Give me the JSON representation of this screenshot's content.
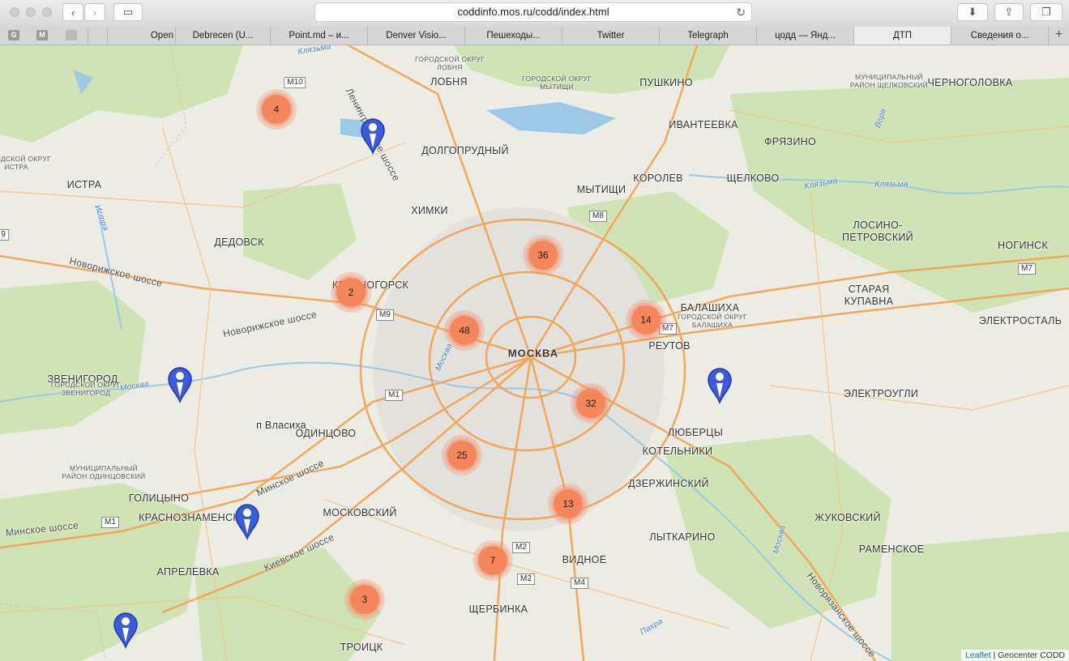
{
  "browser": {
    "url": "coddinfo.mos.ru/codd/index.html",
    "tabs": [
      {
        "label": "Open",
        "active": false
      },
      {
        "label": "Debrecen (U...",
        "active": false
      },
      {
        "label": "Point.md – и...",
        "active": false
      },
      {
        "label": "Denver Visio...",
        "active": false
      },
      {
        "label": "Пешеходы...",
        "active": false
      },
      {
        "label": "Twitter",
        "active": false
      },
      {
        "label": "Telegraph",
        "active": false
      },
      {
        "label": "цодд — Янд...",
        "active": false
      },
      {
        "label": "ДТП",
        "active": true
      },
      {
        "label": "Сведения о...",
        "active": false
      }
    ],
    "bookmarks": [
      "G",
      "M",
      "mail"
    ]
  },
  "map": {
    "places": [
      {
        "name": "ЛОБНЯ"
      },
      {
        "name": "ПУШКИНО"
      },
      {
        "name": "ЧЕРНОГОЛОВКА"
      },
      {
        "name": "ДОЛГОПРУДНЫЙ"
      },
      {
        "name": "ИВАНТЕЕВКА"
      },
      {
        "name": "ФРЯЗИНО"
      },
      {
        "name": "ИСТРА"
      },
      {
        "name": "КОРОЛЕВ"
      },
      {
        "name": "ЩЕЛКОВО"
      },
      {
        "name": "ХИМКИ"
      },
      {
        "name": "МЫТИЩИ"
      },
      {
        "name": "ЛОСИНО-"
      },
      {
        "name": "ПЕТРОВСКИЙ"
      },
      {
        "name": "ДЕДОВСК"
      },
      {
        "name": "НОГИНСК"
      },
      {
        "name": "КРАСНОГОРСК"
      },
      {
        "name": "СТАРАЯ"
      },
      {
        "name": "КУПАВНА"
      },
      {
        "name": "БАЛАШИХА"
      },
      {
        "name": "ЭЛЕКТРОСТАЛЬ"
      },
      {
        "name": "МОСКВА"
      },
      {
        "name": "РЕУТОВ"
      },
      {
        "name": "ЗВЕНИГОРОД"
      },
      {
        "name": "ЭЛЕКТРОУГЛИ"
      },
      {
        "name": "ОДИНЦОВО"
      },
      {
        "name": "ЛЮБЕРЦЫ"
      },
      {
        "name": "КОТЕЛЬНИКИ"
      },
      {
        "name": "ДЗЕРЖИНСКИЙ"
      },
      {
        "name": "ГОЛИЦЫНО"
      },
      {
        "name": "КРАСНОЗНАМЕНСК"
      },
      {
        "name": "МОСКОВСКИЙ"
      },
      {
        "name": "ЖУКОВСКИЙ"
      },
      {
        "name": "ЛЫТКАРИНО"
      },
      {
        "name": "ВИДНОЕ"
      },
      {
        "name": "РАМЕНСКОЕ"
      },
      {
        "name": "АПРЕЛЕВКА"
      },
      {
        "name": "ЩЕРБИНКА"
      },
      {
        "name": "ТРОИЦК"
      },
      {
        "name": "п Власиха"
      }
    ],
    "districts": [
      "ГОРОДСКОЙ ОКРУГ ЛОБНЯ",
      "ГОРОДСКОЙ ОКРУГ МЫТИЩИ",
      "МУНИЦИПАЛЬНЫЙ РАЙОН ЩЕЛКОВСКИЙ",
      "ГОРОДСКОЙ ОКРУГ ИСТРА",
      "ГОРОДСКОЙ ОКРУГ БАЛАШИХА",
      "ГОРОДСКОЙ ОКРУГ ЗВЕНИГОРОД",
      "МУНИЦИПАЛЬНЫЙ РАЙОН ОДИНЦОВСКИЙ"
    ],
    "roads": [
      "Ленинградское шоссе",
      "Новорижское шоссе",
      "Новорижское шоссе",
      "Минское шоссе",
      "Киевское шоссе",
      "Минское шоссе",
      "Новорязанское шоссе"
    ],
    "rivers": [
      "Москва",
      "Москва",
      "Москва",
      "Клязьма",
      "Клязьма",
      "Клязьма",
      "Истра",
      "Воря",
      "Пахра"
    ],
    "shields": [
      "M10",
      "M8",
      "M9",
      "M7",
      "M7",
      "M1",
      "M1",
      "M2",
      "M2",
      "M4",
      "9"
    ],
    "clusters": [
      4,
      2,
      36,
      48,
      14,
      32,
      25,
      13,
      7,
      3
    ],
    "pins": [
      "accident-pin",
      "accident-pin",
      "accident-pin",
      "accident-pin",
      "accident-pin"
    ],
    "attribution": {
      "link": "Leaflet",
      "text": " | Geocenter CODD"
    },
    "colors": {
      "cluster": "#f5855a",
      "pin": "#3b5bdb",
      "road": "#f2a85a",
      "forest": "#cfe3b4",
      "water": "#9cc9e8"
    }
  }
}
